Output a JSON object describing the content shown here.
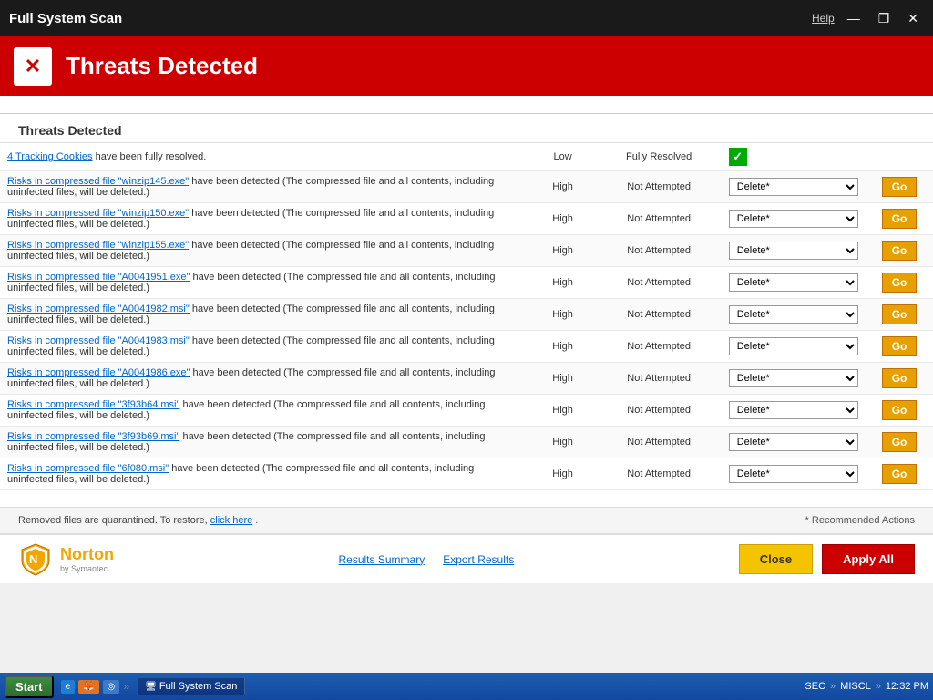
{
  "titleBar": {
    "title": "Full System Scan",
    "help": "Help",
    "minimize": "—",
    "restore": "❐",
    "close": "✕"
  },
  "threatsBanner": {
    "icon": "✕",
    "title": "Threats Detected"
  },
  "sectionTitle": "Threats Detected",
  "tableRows": [
    {
      "description_pre": "",
      "link_text": "4 Tracking Cookies",
      "description_post": " have been fully resolved.",
      "severity": "Low",
      "status": "Fully Resolved",
      "action": "",
      "resolved": true
    },
    {
      "link_text": "Risks in compressed file \"winzip145.exe\"",
      "description_post": " have been detected (The compressed file and all contents, including uninfected files, will be deleted.)",
      "severity": "High",
      "status": "Not Attempted",
      "action": "Delete*",
      "resolved": false
    },
    {
      "link_text": "Risks in compressed file \"winzip150.exe\"",
      "description_post": " have been detected (The compressed file and all contents, including uninfected files, will be deleted.)",
      "severity": "High",
      "status": "Not Attempted",
      "action": "Delete*",
      "resolved": false
    },
    {
      "link_text": "Risks in compressed file \"winzip155.exe\"",
      "description_post": " have been detected (The compressed file and all contents, including uninfected files, will be deleted.)",
      "severity": "High",
      "status": "Not Attempted",
      "action": "Delete*",
      "resolved": false
    },
    {
      "link_text": "Risks in compressed file \"A0041951.exe\"",
      "description_post": " have been detected (The compressed file and all contents, including uninfected files, will be deleted.)",
      "severity": "High",
      "status": "Not Attempted",
      "action": "Delete*",
      "resolved": false
    },
    {
      "link_text": "Risks in compressed file \"A0041982.msi\"",
      "description_post": " have been detected (The compressed file and all contents, including uninfected files, will be deleted.)",
      "severity": "High",
      "status": "Not Attempted",
      "action": "Delete*",
      "resolved": false
    },
    {
      "link_text": "Risks in compressed file \"A0041983.msi\"",
      "description_post": " have been detected (The compressed file and all contents, including uninfected files, will be deleted.)",
      "severity": "High",
      "status": "Not Attempted",
      "action": "Delete*",
      "resolved": false
    },
    {
      "link_text": "Risks in compressed file \"A0041986.exe\"",
      "description_post": " have been detected (The compressed file and all contents, including uninfected files, will be deleted.)",
      "severity": "High",
      "status": "Not Attempted",
      "action": "Delete*",
      "resolved": false
    },
    {
      "link_text": "Risks in compressed file \"3f93b64.msi\"",
      "description_post": " have been detected (The compressed file and all contents, including uninfected files, will be deleted.)",
      "severity": "High",
      "status": "Not Attempted",
      "action": "Delete*",
      "resolved": false
    },
    {
      "link_text": "Risks in compressed file \"3f93b69.msi\"",
      "description_post": " have been detected (The compressed file and all contents, including uninfected files, will be deleted.)",
      "severity": "High",
      "status": "Not Attempted",
      "action": "Delete*",
      "resolved": false
    },
    {
      "link_text": "Risks in compressed file \"6f080.msi\"",
      "description_post": " have been detected (The compressed file and all contents, including uninfected files, will be deleted.)",
      "severity": "High",
      "status": "Not Attempted",
      "action": "Delete*",
      "resolved": false
    }
  ],
  "quarantineNotice": {
    "text": "Removed files are quarantined. To restore,",
    "linkText": "click here",
    "note": "* Recommended Actions"
  },
  "bottomBar": {
    "nortonBrand": "Norton",
    "nortonSub": "by Symantec",
    "resultsSummary": "Results Summary",
    "exportResults": "Export Results",
    "closeLabel": "Close",
    "applyAllLabel": "Apply All"
  },
  "taskbar": {
    "start": "Start",
    "activeWindow": "Full System Scan",
    "tray": {
      "sec": "SEC",
      "miscl": "MISCL",
      "time": "12:32 PM"
    }
  }
}
